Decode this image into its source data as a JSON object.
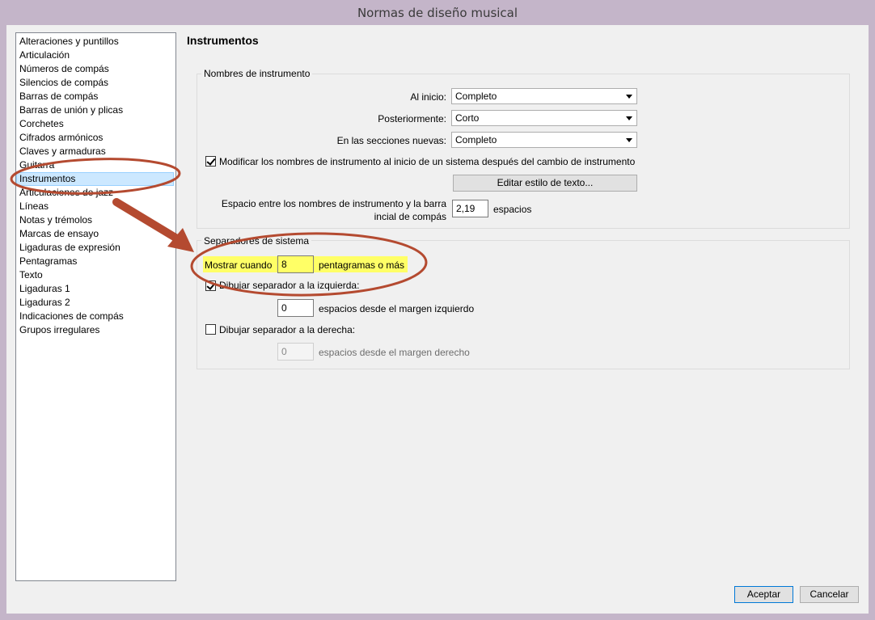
{
  "window": {
    "title": "Normas de diseño musical"
  },
  "categories": [
    "Alteraciones y puntillos",
    "Articulación",
    "Números de compás",
    "Silencios de compás",
    "Barras de compás",
    "Barras de unión y plicas",
    "Corchetes",
    "Cifrados armónicos",
    "Claves y armaduras",
    "Guitarra",
    "Instrumentos",
    "Articulaciones de jazz",
    "Líneas",
    "Notas y trémolos",
    "Marcas de ensayo",
    "Ligaduras de expresión",
    "Pentagramas",
    "Texto",
    "Ligaduras 1",
    "Ligaduras 2",
    "Indicaciones de compás",
    "Grupos irregulares"
  ],
  "selected_category": "Instrumentos",
  "page_title": "Instrumentos",
  "names_group": {
    "label": "Nombres de instrumento",
    "at_start_label": "Al inicio:",
    "at_start_value": "Completo",
    "subsequent_label": "Posteriormente:",
    "subsequent_value": "Corto",
    "new_sections_label": "En las secciones nuevas:",
    "new_sections_value": "Completo",
    "change_checkbox_label": "Modificar los nombres de instrumento al inicio de un sistema después del cambio de instrumento",
    "change_checkbox_checked": true,
    "edit_text_style_button": "Editar estilo de texto...",
    "gap_label_line1": "Espacio entre los nombres de instrumento y la barra",
    "gap_label_line2": "incial de compás",
    "gap_value": "2,19",
    "gap_unit": "espacios"
  },
  "separators_group": {
    "label": "Separadores de sistema",
    "show_when_label": "Mostrar cuando",
    "show_when_value": "8",
    "show_when_suffix": "pentagramas o más",
    "left_checkbox_label": "Dibujar separador a la izquierda:",
    "left_checkbox_checked": true,
    "left_margin_value": "0",
    "left_margin_suffix": "espacios desde el margen izquierdo",
    "right_checkbox_label": "Dibujar separador a la derecha:",
    "right_checkbox_checked": false,
    "right_margin_value": "0",
    "right_margin_suffix": "espacios desde el margen derecho"
  },
  "buttons": {
    "ok": "Aceptar",
    "cancel": "Cancelar"
  },
  "colors": {
    "highlight": "#ffff66",
    "annotation": "#b44a30",
    "selection": "#cce8ff"
  }
}
